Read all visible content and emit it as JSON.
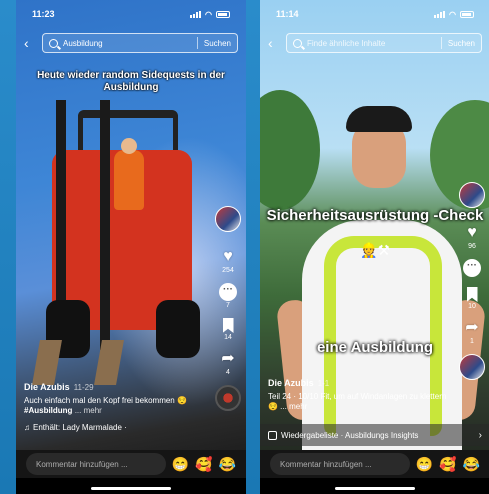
{
  "left": {
    "status": {
      "time": "11:23"
    },
    "search": {
      "query": "Ausbildung",
      "button": "Suchen"
    },
    "overlay_text": "Heute wieder random Sidequests in der Ausbildung",
    "actions": {
      "likes": "254",
      "comments": "7",
      "saves": "14",
      "shares": "4"
    },
    "post": {
      "author": "Die Azubis",
      "time": "11-29",
      "desc_text": "Auch einfach mal den Kopf frei bekommen 😌",
      "hashtag": "#Ausbildung",
      "more": "... mehr",
      "music": "Enthält: Lady Marmalade ·"
    },
    "comment": {
      "placeholder": "Kommentar hinzufügen ...",
      "emojis": [
        "😁",
        "🥰",
        "😂"
      ]
    }
  },
  "right": {
    "status": {
      "time": "11:14"
    },
    "search": {
      "placeholder": "Finde ähnliche Inhalte",
      "button": "Suchen"
    },
    "overlay_title": "Sicherheitsausrüstung -Check",
    "overlay_emojis": "👷⚒",
    "overlay_sub": "eine Ausbildung",
    "actions": {
      "likes": "96",
      "comments": "",
      "saves": "10",
      "shares": "1"
    },
    "post": {
      "author": "Die Azubis",
      "time": "1-1",
      "desc": "Teil 24 · 10/10 Fit, um auf Windanlagen zu klettern 😌 ... mehr"
    },
    "playlist": "Wiedergabeliste · Ausbildungs Insights",
    "comment": {
      "placeholder": "Kommentar hinzufügen ...",
      "emojis": [
        "😁",
        "🥰",
        "😂"
      ]
    }
  },
  "icons": [
    "back-arrow-icon",
    "search-icon",
    "heart-icon",
    "comment-icon",
    "bookmark-icon",
    "share-icon",
    "music-note-icon",
    "playlist-icon",
    "chevron-right-icon"
  ]
}
